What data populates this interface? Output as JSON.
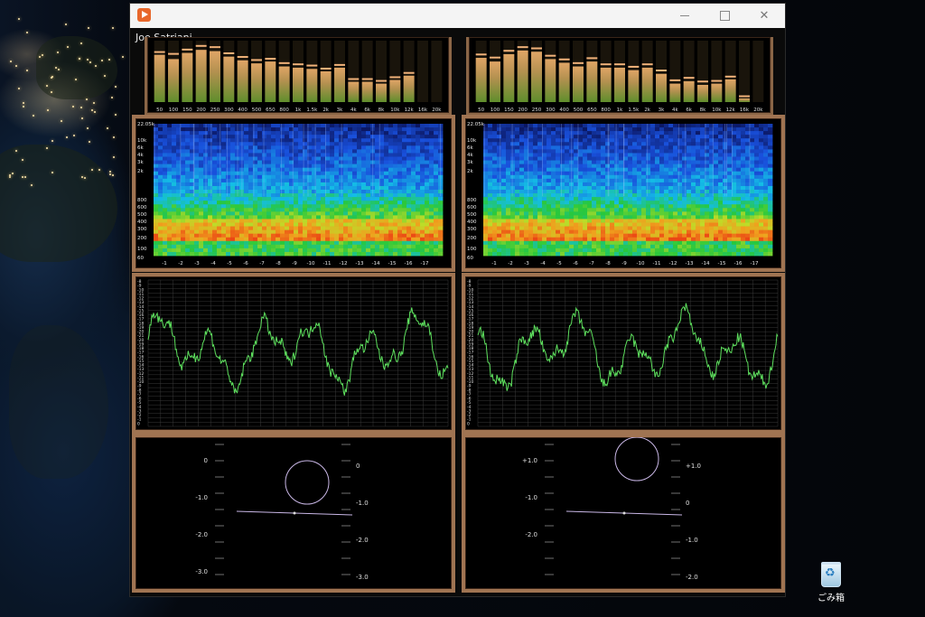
{
  "window": {
    "title_text": ""
  },
  "track": {
    "title": "Joe Satriani"
  },
  "desktop": {
    "recycle_bin_label": "ごみ箱"
  },
  "equalizer": {
    "bands": [
      "50",
      "100",
      "150",
      "200",
      "250",
      "300",
      "400",
      "500",
      "650",
      "800",
      "1k",
      "1.5k",
      "2k",
      "3k",
      "4k",
      "6k",
      "8k",
      "10k",
      "12k",
      "16k",
      "20k"
    ],
    "left_levels": [
      0.77,
      0.7,
      0.8,
      0.85,
      0.83,
      0.74,
      0.68,
      0.63,
      0.66,
      0.58,
      0.56,
      0.54,
      0.5,
      0.56,
      0.33,
      0.33,
      0.3,
      0.36,
      0.43,
      0,
      0
    ],
    "left_peaks": [
      0.8,
      0.77,
      0.84,
      0.9,
      0.88,
      0.78,
      0.72,
      0.67,
      0.69,
      0.62,
      0.6,
      0.58,
      0.53,
      0.59,
      0.36,
      0.36,
      0.33,
      0.39,
      0.46,
      0,
      0
    ],
    "right_levels": [
      0.72,
      0.66,
      0.78,
      0.84,
      0.82,
      0.7,
      0.64,
      0.58,
      0.66,
      0.56,
      0.56,
      0.52,
      0.56,
      0.46,
      0.3,
      0.34,
      0.28,
      0.3,
      0.37,
      0.06,
      0
    ],
    "right_peaks": [
      0.76,
      0.71,
      0.82,
      0.88,
      0.86,
      0.74,
      0.68,
      0.62,
      0.7,
      0.6,
      0.6,
      0.56,
      0.6,
      0.5,
      0.34,
      0.38,
      0.32,
      0.33,
      0.4,
      0.08,
      0
    ]
  },
  "spectrogram": {
    "freq_labels": [
      "22.05k",
      "10k",
      "6k",
      "4k",
      "3k",
      "2k",
      "800",
      "600",
      "500",
      "400",
      "300",
      "200",
      "100",
      "60"
    ],
    "time_labels": [
      "-1",
      "-2",
      "-3",
      "-4",
      "-5",
      "-6",
      "-7",
      "-8",
      "-9",
      "-10",
      "-11",
      "-12",
      "-13",
      "-14",
      "-15",
      "-16",
      "-17"
    ]
  },
  "waveform": {
    "y_labels": [
      "-8",
      "-9",
      "-10",
      "-11",
      "-12",
      "-13",
      "-14",
      "-15",
      "-16",
      "-17",
      "-18",
      "-19",
      "-20",
      "-21",
      "-20",
      "-19",
      "-18",
      "-17",
      "-16",
      "-15",
      "-14",
      "-13",
      "-12",
      "-11",
      "-10",
      "-9",
      "-8",
      "-7",
      "-6",
      "-5",
      "-4",
      "-3",
      "-2",
      "-1",
      "0"
    ]
  },
  "level_meters": {
    "left": {
      "left_scale": [
        "0",
        "-1.0",
        "-2.0",
        "-3.0"
      ],
      "right_scale": [
        "0",
        "-1.0",
        "-2.0",
        "-3.0"
      ]
    },
    "right": {
      "left_scale": [
        "+1.0",
        "-1.0",
        "-2.0"
      ],
      "right_scale": [
        "+1.0",
        "0",
        "-1.0",
        "-2.0"
      ]
    }
  },
  "colors": {
    "frame": "#a07452",
    "trace": "#5ee05e",
    "meter": "#c9b7e6"
  }
}
